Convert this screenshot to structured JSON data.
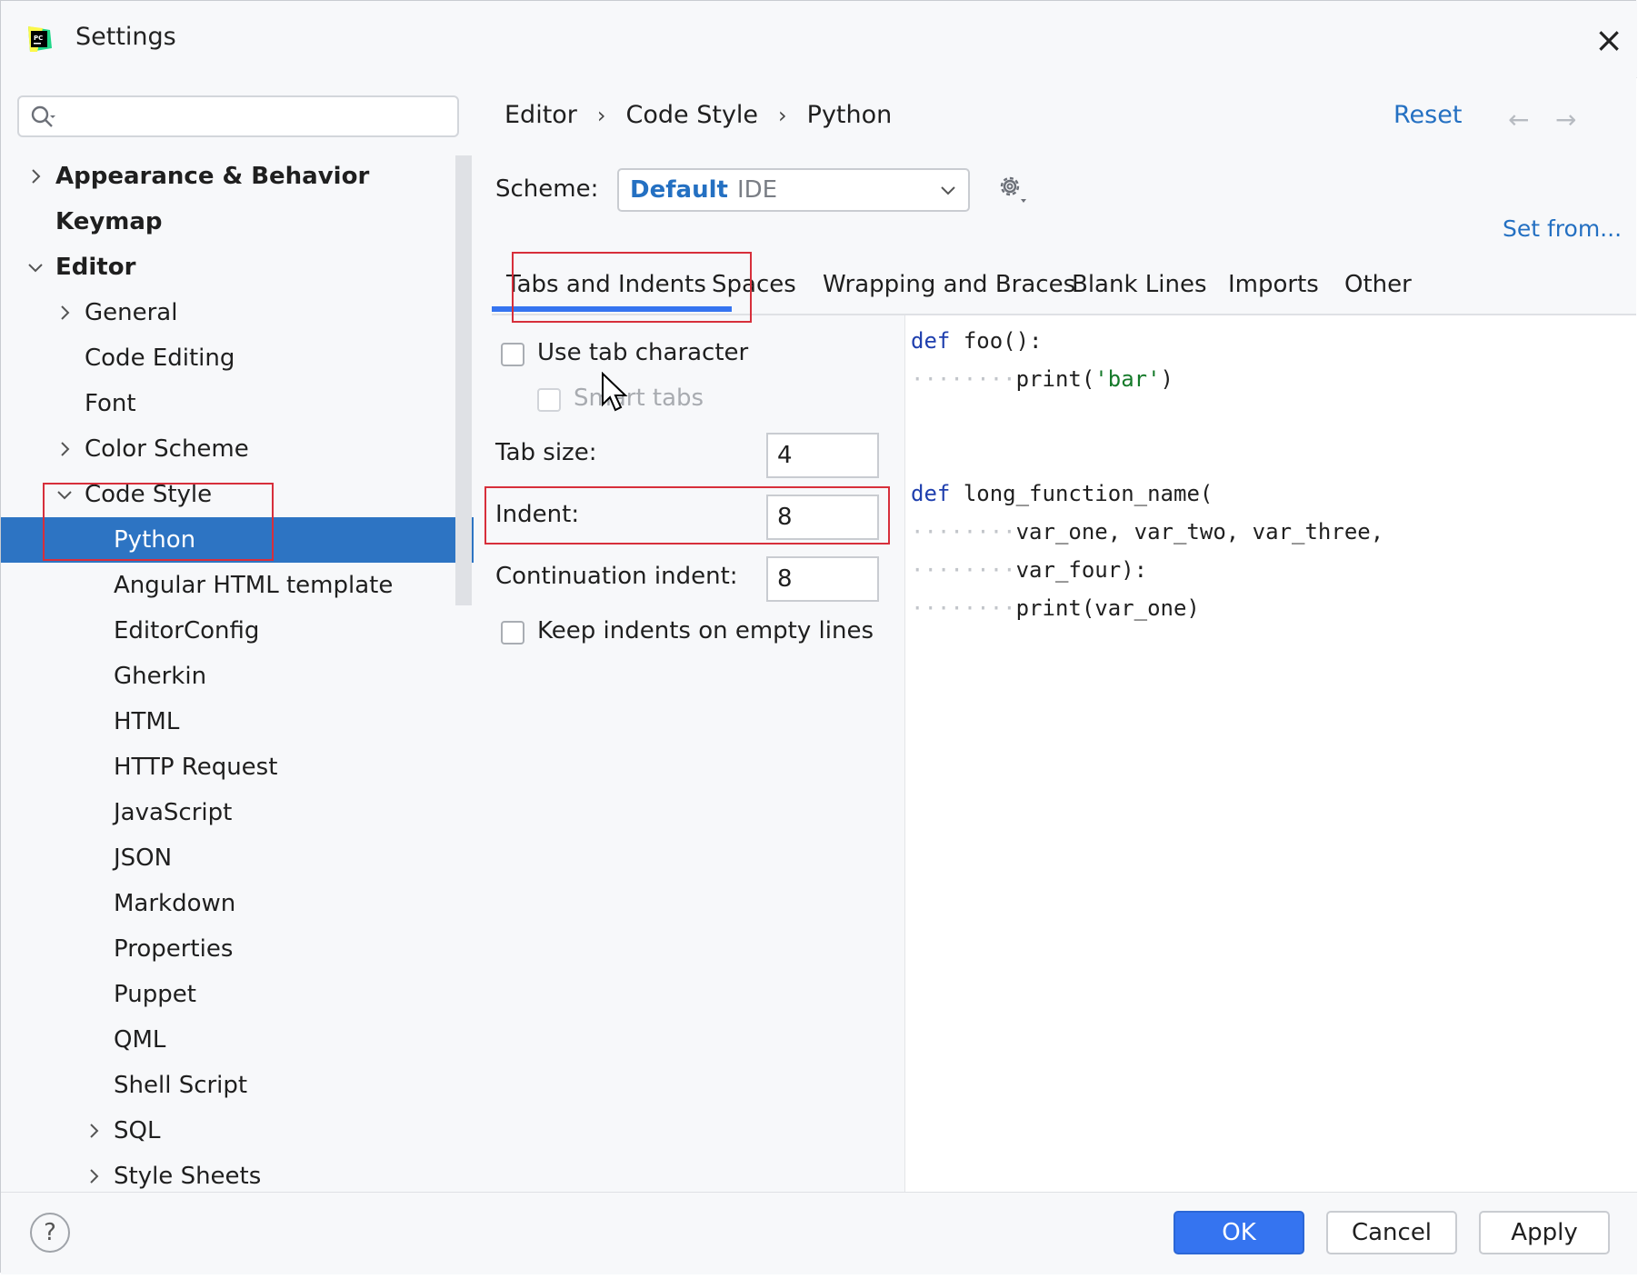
{
  "window": {
    "title": "Settings"
  },
  "search": {
    "placeholder": ""
  },
  "tree": [
    {
      "label": "Appearance & Behavior",
      "chevron": "right"
    },
    {
      "label": "Keymap",
      "chevron": ""
    },
    {
      "label": "Editor",
      "chevron": "down"
    },
    {
      "label": "General",
      "chevron": "right"
    },
    {
      "label": "Code Editing",
      "chevron": ""
    },
    {
      "label": "Font",
      "chevron": ""
    },
    {
      "label": "Color Scheme",
      "chevron": "right"
    },
    {
      "label": "Code Style",
      "chevron": "down"
    },
    {
      "label": "Python",
      "chevron": "",
      "selected": true
    },
    {
      "label": "Angular HTML template",
      "chevron": ""
    },
    {
      "label": "EditorConfig",
      "chevron": ""
    },
    {
      "label": "Gherkin",
      "chevron": ""
    },
    {
      "label": "HTML",
      "chevron": ""
    },
    {
      "label": "HTTP Request",
      "chevron": ""
    },
    {
      "label": "JavaScript",
      "chevron": ""
    },
    {
      "label": "JSON",
      "chevron": ""
    },
    {
      "label": "Markdown",
      "chevron": ""
    },
    {
      "label": "Properties",
      "chevron": ""
    },
    {
      "label": "Puppet",
      "chevron": ""
    },
    {
      "label": "QML",
      "chevron": ""
    },
    {
      "label": "Shell Script",
      "chevron": ""
    },
    {
      "label": "SQL",
      "chevron": "right"
    },
    {
      "label": "Style Sheets",
      "chevron": "right"
    }
  ],
  "breadcrumb": [
    "Editor",
    "Code Style",
    "Python"
  ],
  "header": {
    "reset": "Reset"
  },
  "scheme": {
    "label": "Scheme:",
    "name": "Default",
    "type": "IDE",
    "set_from": "Set from..."
  },
  "tabs": [
    "Tabs and Indents",
    "Spaces",
    "Wrapping and Braces",
    "Blank Lines",
    "Imports",
    "Other"
  ],
  "options": {
    "use_tab_character": "Use tab character",
    "smart_tabs": "Smart tabs",
    "tab_size_label": "Tab size:",
    "tab_size": "4",
    "indent_label": "Indent:",
    "indent": "8",
    "continuation_label": "Continuation indent:",
    "continuation": "8",
    "keep_indents": "Keep indents on empty lines"
  },
  "preview": {
    "line1_kw": "def",
    "line1_rest": "foo():",
    "line2_dots": "········",
    "line2_pre": "print(",
    "line2_str": "'bar'",
    "line2_post": ")",
    "line3_kw": "def",
    "line3_rest": "long_function_name(",
    "line4_dots": "········",
    "line4_code": "var_one, var_two, var_three,",
    "line5_dots": "········",
    "line5_code": "var_four):",
    "line6_dots": "········",
    "line6_code": "print(var_one)"
  },
  "footer": {
    "help": "?",
    "ok": "OK",
    "cancel": "Cancel",
    "apply": "Apply"
  },
  "colors": {
    "accent": "#3574f0",
    "selection": "#2d74c3",
    "link": "#2470c2",
    "highlight": "#d72f3b"
  }
}
